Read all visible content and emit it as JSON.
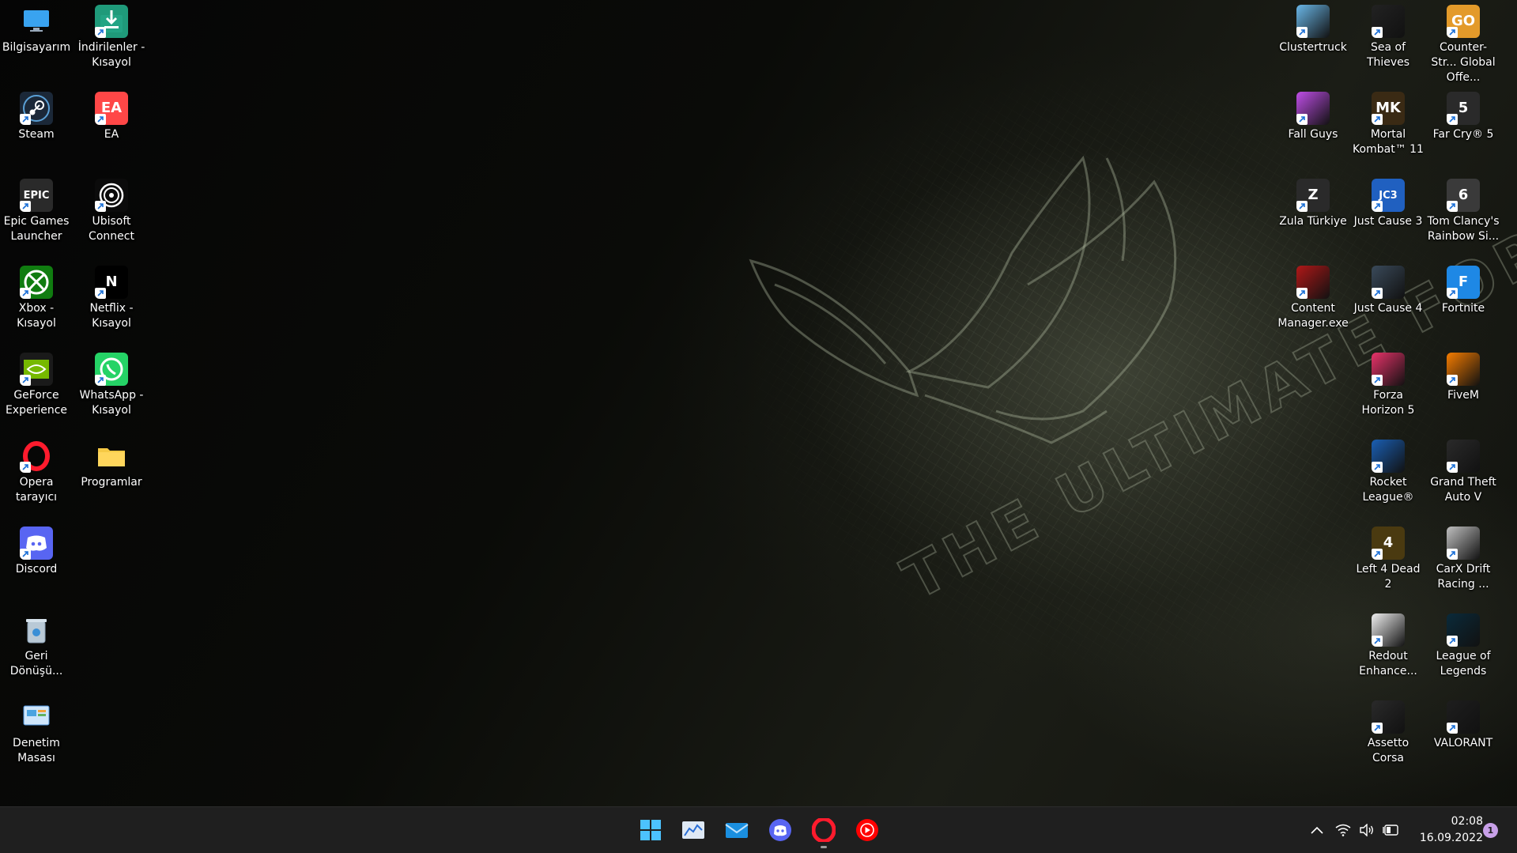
{
  "desktop": {
    "left_icons": [
      {
        "label": "Bilgisayarım",
        "icon": "monitor-icon",
        "color": "#3aa0e8",
        "shortcut": false
      },
      {
        "label": "Steam",
        "icon": "steam-icon",
        "color": "#1b2838",
        "shortcut": true
      },
      {
        "label": "Epic Games Launcher",
        "icon": "epic-games-icon",
        "color": "#2a2a2a",
        "shortcut": true,
        "text": "EPIC"
      },
      {
        "label": "Xbox - Kısayol",
        "icon": "xbox-icon",
        "color": "#107c10",
        "shortcut": true
      },
      {
        "label": "GeForce Experience",
        "icon": "nvidia-icon",
        "color": "#1a1a1a",
        "shortcut": true
      },
      {
        "label": "Opera tarayıcı",
        "icon": "opera-icon",
        "color": "transparent",
        "shortcut": true
      },
      {
        "label": "Discord",
        "icon": "discord-icon",
        "color": "#5865f2",
        "shortcut": true
      },
      {
        "label": "Geri Dönüşü...",
        "icon": "recycle-bin-icon",
        "color": "#6f8aa0",
        "shortcut": false
      },
      {
        "label": "Denetim Masası",
        "icon": "control-panel-icon",
        "color": "#4aa3e0",
        "shortcut": false
      },
      {
        "label": "İndirilenler - Kısayol",
        "icon": "downloads-folder-icon",
        "color": "#1f9a7a",
        "shortcut": true
      },
      {
        "label": "EA",
        "icon": "ea-icon",
        "color": "#ff4747",
        "shortcut": true,
        "text": "EA"
      },
      {
        "label": "Ubisoft Connect",
        "icon": "ubisoft-icon",
        "color": "#0b0b0b",
        "shortcut": true
      },
      {
        "label": "Netflix - Kısayol",
        "icon": "netflix-icon",
        "color": "#000000",
        "shortcut": true,
        "text": "N"
      },
      {
        "label": "WhatsApp - Kısayol",
        "icon": "whatsapp-icon",
        "color": "#25d366",
        "shortcut": true
      },
      {
        "label": "Programlar",
        "icon": "folder-icon",
        "color": "#f4c430",
        "shortcut": false
      }
    ],
    "right_icons": [
      {
        "label": "Clustertruck",
        "icon": "clustertruck-icon",
        "color": "#6ab7e8",
        "shortcut": true
      },
      {
        "label": "Fall Guys",
        "icon": "fall-guys-icon",
        "color": "#c04ee8",
        "shortcut": true
      },
      {
        "label": "Zula Türkiye",
        "icon": "zula-icon",
        "color": "#2a2a2a",
        "shortcut": true,
        "text": "Z"
      },
      {
        "label": "Content Manager.exe",
        "icon": "content-manager-icon",
        "color": "#b01818",
        "shortcut": true
      },
      {
        "label": "Sea of Thieves",
        "icon": "sea-of-thieves-icon",
        "color": "#222222",
        "shortcut": true
      },
      {
        "label": "Mortal Kombat™ 11",
        "icon": "mortal-kombat-icon",
        "color": "#3a2a14",
        "shortcut": true,
        "text": "MK"
      },
      {
        "label": "Just Cause 3",
        "icon": "just-cause-3-icon",
        "color": "#2060c0",
        "shortcut": true,
        "text": "JC3"
      },
      {
        "label": "Just Cause 4",
        "icon": "just-cause-4-icon",
        "color": "#3a4a5a",
        "shortcut": true
      },
      {
        "label": "Forza Horizon 5",
        "icon": "forza-icon",
        "color": "#e8336a",
        "shortcut": true
      },
      {
        "label": "Rocket League®",
        "icon": "rocket-league-icon",
        "color": "#1a5fb4",
        "shortcut": true
      },
      {
        "label": "Left 4 Dead 2",
        "icon": "left4dead-icon",
        "color": "#4a3a10",
        "shortcut": true,
        "text": "4"
      },
      {
        "label": "Redout Enhance...",
        "icon": "redout-icon",
        "color": "#f0f0f0",
        "shortcut": true
      },
      {
        "label": "Assetto Corsa",
        "icon": "assetto-corsa-icon",
        "color": "#2a2a2a",
        "shortcut": true
      },
      {
        "label": "Counter-Str... Global Offe...",
        "icon": "csgo-icon",
        "color": "#e39a2a",
        "shortcut": true,
        "text": "GO"
      },
      {
        "label": "Far Cry® 5",
        "icon": "far-cry-5-icon",
        "color": "#2a2a2a",
        "shortcut": true,
        "text": "5"
      },
      {
        "label": "Tom Clancy's Rainbow Si...",
        "icon": "rainbow-six-icon",
        "color": "#3a3a3a",
        "shortcut": true,
        "text": "6"
      },
      {
        "label": "Fortnite",
        "icon": "fortnite-icon",
        "color": "#1e88e5",
        "shortcut": true,
        "text": "F"
      },
      {
        "label": "FiveM",
        "icon": "fivem-icon",
        "color": "#f57c00",
        "shortcut": true
      },
      {
        "label": "Grand Theft Auto V",
        "icon": "gta-v-icon",
        "color": "#2a2a2a",
        "shortcut": true
      },
      {
        "label": "CarX Drift Racing ...",
        "icon": "carx-icon",
        "color": "#c0c0c0",
        "shortcut": true
      },
      {
        "label": "League of Legends",
        "icon": "league-of-legends-icon",
        "color": "#0a2a3a",
        "shortcut": true
      },
      {
        "label": "VALORANT",
        "icon": "valorant-icon",
        "color": "#1e1e1e",
        "shortcut": true
      }
    ]
  },
  "wallpaper": {
    "text": "THE ULTIMATE FORCE"
  },
  "taskbar": {
    "apps": [
      {
        "name": "start",
        "icon": "windows-start-icon"
      },
      {
        "name": "stocks",
        "icon": "chart-app-icon"
      },
      {
        "name": "mail",
        "icon": "mail-icon"
      },
      {
        "name": "discord",
        "icon": "discord-icon"
      },
      {
        "name": "opera",
        "icon": "opera-icon"
      },
      {
        "name": "youtube-music",
        "icon": "youtube-music-icon"
      }
    ],
    "tray": [
      "chevron-up-icon",
      "wifi-icon",
      "volume-icon",
      "battery-icon"
    ],
    "time": "02:08",
    "date": "16.09.2022",
    "notification_count": "1"
  }
}
